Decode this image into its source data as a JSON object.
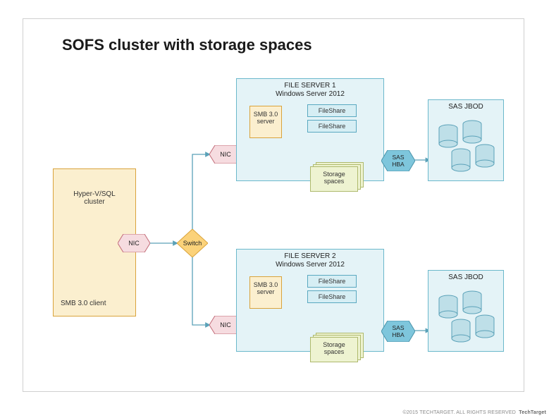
{
  "title": "SOFS cluster with storage spaces",
  "client": {
    "line1": "Hyper-V/SQL",
    "line2": "cluster",
    "bottom": "SMB 3.0 client"
  },
  "nic": "NIC",
  "switch": "Switch",
  "server1": {
    "hdr1": "FILE SERVER 1",
    "hdr2": "Windows Server 2012"
  },
  "server2": {
    "hdr1": "FILE SERVER 2",
    "hdr2": "Windows Server 2012"
  },
  "smb": {
    "line1": "SMB 3.0",
    "line2": "server"
  },
  "fs": "FileShare",
  "storage": {
    "line1": "Storage",
    "line2": "spaces"
  },
  "sashba": {
    "line1": "SAS",
    "line2": "HBA"
  },
  "jbod": "SAS JBOD",
  "footer": {
    "copyright": "©2015 TECHTARGET. ALL RIGHTS RESERVED",
    "brand": "TechTarget"
  }
}
